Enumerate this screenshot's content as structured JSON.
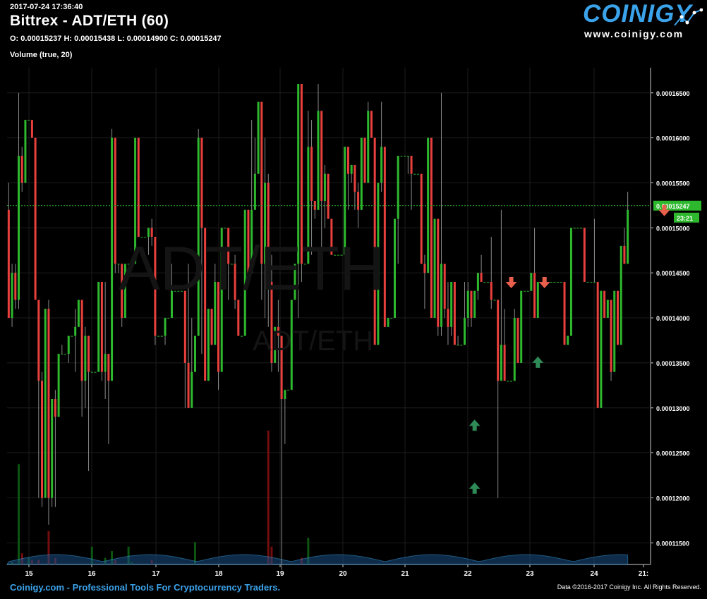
{
  "header": {
    "timestamp": "2017-07-24 17:36:40",
    "title": "Bittrex - ADT/ETH (60)",
    "ohlc": "O: 0.00015237 H: 0.00015438 L: 0.00014900 C: 0.00015247",
    "volume_label": "Volume (true, 20)"
  },
  "logo": {
    "text": "COINIGY",
    "url": "www.coinigy.com"
  },
  "watermark": {
    "big": "ADT/ETH",
    "small": "ADT/ETH"
  },
  "footer": {
    "left": "Coinigy.com - Professional Tools For Cryptocurrency Traders.",
    "right": "Data ©2016-2017 Coinigy Inc. All Rights Reserved."
  },
  "colors": {
    "up": "#2eb82e",
    "down": "#e8403c",
    "grid": "#1c1c1c",
    "accent": "#3ba3ea",
    "volume_ma": "#1f5f9a"
  },
  "chart_data": {
    "type": "candlestick",
    "title": "Bittrex - ADT/ETH (60)",
    "xlabel": "",
    "ylabel": "",
    "x_ticks": [
      "15",
      "16",
      "17",
      "18",
      "19",
      "20",
      "21",
      "22",
      "23",
      "24",
      "21:"
    ],
    "y_ticks": [
      "0.00016500",
      "0.00016000",
      "0.00015500",
      "0.00015000",
      "0.00014500",
      "0.00014000",
      "0.00013500",
      "0.00013000",
      "0.00012500",
      "0.00012000",
      "0.00011500"
    ],
    "ylim": [
      0.0001126,
      0.0001678
    ],
    "last_price": "0.00015247",
    "countdown": "23:21",
    "grid": true,
    "candles": [
      [
        0.000152,
        0.00014,
        0.000155,
        0.00014
      ],
      [
        0.00014,
        0.000145,
        0.000146,
        0.000139
      ],
      [
        0.000145,
        0.000142,
        0.000146,
        0.000141
      ],
      [
        0.000142,
        0.000158,
        0.000165,
        0.000141
      ],
      [
        0.000158,
        0.000155,
        0.000159,
        0.000154
      ],
      [
        0.000155,
        0.000162,
        0.000162,
        0.000155
      ],
      [
        0.000162,
        0.000162,
        0.000162,
        0.000162
      ],
      [
        0.000162,
        0.00016,
        0.000162,
        0.00016
      ],
      [
        0.00016,
        0.000142,
        0.00016,
        0.000142
      ],
      [
        0.000142,
        0.000133,
        0.000142,
        0.00012
      ],
      [
        0.000133,
        0.00012,
        0.000134,
        0.000119
      ],
      [
        0.00012,
        0.000141,
        0.000141,
        0.00012
      ],
      [
        0.000141,
        0.00012,
        0.000142,
        0.000117
      ],
      [
        0.00012,
        0.000131,
        0.000131,
        0.000119
      ],
      [
        0.000131,
        0.000129,
        0.000132,
        0.000119
      ],
      [
        0.000129,
        0.000136,
        0.000136,
        0.000129
      ],
      [
        0.000136,
        0.000136,
        0.000137,
        0.000136
      ],
      [
        0.000136,
        0.000136,
        0.000136,
        0.000136
      ],
      [
        0.000136,
        0.000138,
        0.000138,
        0.000135
      ],
      [
        0.000138,
        0.000138,
        0.000138,
        0.000138
      ],
      [
        0.000138,
        0.000139,
        0.000141,
        0.000134
      ],
      [
        0.000139,
        0.000142,
        0.000142,
        0.000139
      ],
      [
        0.000142,
        0.000133,
        0.000142,
        0.000129
      ],
      [
        0.000133,
        0.000138,
        0.000139,
        0.00013
      ],
      [
        0.000138,
        0.000134,
        0.000138,
        0.000123
      ],
      [
        0.000134,
        0.000134,
        0.000134,
        0.000134
      ],
      [
        0.000134,
        0.000134,
        0.000134,
        0.000134
      ],
      [
        0.000134,
        0.000144,
        0.000144,
        0.000134
      ],
      [
        0.000144,
        0.000134,
        0.000144,
        0.000133
      ],
      [
        0.000134,
        0.000136,
        0.000144,
        0.000131
      ],
      [
        0.000136,
        0.000133,
        0.000136,
        0.000126
      ],
      [
        0.000133,
        0.00016,
        0.000161,
        0.000133
      ],
      [
        0.00016,
        0.000146,
        0.00016,
        0.000145
      ],
      [
        0.000146,
        0.000146,
        0.000146,
        0.000145
      ],
      [
        0.000146,
        0.00014,
        0.000146,
        0.000139
      ],
      [
        0.00014,
        0.000146,
        0.000146,
        0.00014
      ],
      [
        0.000146,
        0.000146,
        0.000146,
        0.000146
      ],
      [
        0.000146,
        0.000146,
        0.000146,
        0.000146
      ],
      [
        0.000146,
        0.00016,
        0.00016,
        0.000146
      ],
      [
        0.00016,
        0.000149,
        0.00016,
        0.000149
      ],
      [
        0.000149,
        0.000149,
        0.000149,
        0.000149
      ],
      [
        0.000149,
        0.000149,
        0.000149,
        0.000149
      ],
      [
        0.000149,
        0.00015,
        0.00015,
        0.000147
      ],
      [
        0.00015,
        0.000149,
        0.000151,
        0.000148
      ],
      [
        0.000149,
        0.000138,
        0.000149,
        0.000137
      ],
      [
        0.000138,
        0.000138,
        0.000138,
        0.000138
      ],
      [
        0.000138,
        0.000138,
        0.000138,
        0.000138
      ],
      [
        0.000138,
        0.00014,
        0.00014,
        0.000137
      ],
      [
        0.00014,
        0.00014,
        0.00014,
        0.00014
      ],
      [
        0.00014,
        0.000143,
        0.000146,
        0.00014
      ],
      [
        0.000143,
        0.000143,
        0.000143,
        0.000143
      ],
      [
        0.000143,
        0.000143,
        0.000143,
        0.000143
      ],
      [
        0.000143,
        0.000143,
        0.000143,
        0.000143
      ],
      [
        0.000143,
        0.000135,
        0.000143,
        0.00013
      ],
      [
        0.000135,
        0.00013,
        0.000146,
        0.00013
      ],
      [
        0.00013,
        0.000134,
        0.00014,
        0.00013
      ],
      [
        0.000134,
        0.000138,
        0.000138,
        0.000134
      ],
      [
        0.000138,
        0.00016,
        0.000161,
        0.000138
      ],
      [
        0.00016,
        0.00015,
        0.00016,
        0.000136
      ],
      [
        0.00015,
        0.000133,
        0.00015,
        0.000133
      ],
      [
        0.000133,
        0.000141,
        0.000141,
        0.000133
      ],
      [
        0.000141,
        0.000137,
        0.000141,
        0.000137
      ],
      [
        0.000137,
        0.000144,
        0.000146,
        0.000137
      ],
      [
        0.000144,
        0.000134,
        0.000144,
        0.000132
      ],
      [
        0.000134,
        0.00015,
        0.00015,
        0.000134
      ],
      [
        0.00015,
        0.00015,
        0.00015,
        0.00015
      ],
      [
        0.00015,
        0.000146,
        0.00015,
        0.000142
      ],
      [
        0.000146,
        0.000146,
        0.000146,
        0.000146
      ],
      [
        0.000146,
        0.000142,
        0.000147,
        0.000141
      ],
      [
        0.000142,
        0.000138,
        0.000142,
        0.000138
      ],
      [
        0.000138,
        0.000138,
        0.000138,
        0.000138
      ],
      [
        0.000138,
        0.000152,
        0.000152,
        0.000138
      ],
      [
        0.000152,
        0.000145,
        0.000152,
        0.000145
      ],
      [
        0.000145,
        0.000152,
        0.000162,
        0.000145
      ],
      [
        0.000152,
        0.000156,
        0.00016,
        0.000152
      ],
      [
        0.000156,
        0.000164,
        0.000164,
        0.000156
      ],
      [
        0.000164,
        0.000146,
        0.000164,
        0.000142
      ],
      [
        0.000146,
        0.000155,
        0.00016,
        0.00014
      ],
      [
        0.000155,
        0.000144,
        0.000156,
        0.000139
      ],
      [
        0.000144,
        0.000135,
        0.000147,
        0.000134
      ],
      [
        0.000135,
        0.000139,
        0.000139,
        0.000135
      ],
      [
        0.000139,
        0.000138,
        0.000142,
        0.000134
      ],
      [
        0.000138,
        0.000131,
        0.000138,
        0.000112
      ],
      [
        0.000131,
        0.000132,
        0.000132,
        0.000126
      ],
      [
        0.000132,
        0.000132,
        0.000132,
        0.000132
      ],
      [
        0.000132,
        0.000142,
        0.000142,
        0.000132
      ],
      [
        0.000142,
        0.000146,
        0.000146,
        0.000142
      ],
      [
        0.000146,
        0.000166,
        0.000166,
        0.00014
      ],
      [
        0.000166,
        0.000146,
        0.000166,
        0.000144
      ],
      [
        0.000146,
        0.000146,
        0.000146,
        0.000146
      ],
      [
        0.000146,
        0.000159,
        0.000163,
        0.000146
      ],
      [
        0.000159,
        0.000153,
        0.000162,
        0.000147
      ],
      [
        0.000153,
        0.000152,
        0.000152,
        0.000151
      ],
      [
        0.000152,
        0.000163,
        0.000166,
        0.000152
      ],
      [
        0.000163,
        0.000153,
        0.000163,
        0.000147
      ],
      [
        0.000153,
        0.000156,
        0.000157,
        0.00015
      ],
      [
        0.000156,
        0.000151,
        0.000156,
        0.000151
      ],
      [
        0.000151,
        0.000147,
        0.000151,
        0.000147
      ],
      [
        0.000147,
        0.000147,
        0.000147,
        0.000147
      ],
      [
        0.000147,
        0.000147,
        0.000147,
        0.000147
      ],
      [
        0.000147,
        0.000147,
        0.000147,
        0.000147
      ],
      [
        0.000147,
        0.000159,
        0.000159,
        0.000147
      ],
      [
        0.000159,
        0.000156,
        0.000159,
        0.000152
      ],
      [
        0.000156,
        0.000157,
        0.000157,
        0.000155
      ],
      [
        0.000157,
        0.000154,
        0.000157,
        0.000152
      ],
      [
        0.000154,
        0.000152,
        0.000155,
        0.00015
      ],
      [
        0.000152,
        0.00016,
        0.00016,
        0.000152
      ],
      [
        0.00016,
        0.000155,
        0.00016,
        0.000155
      ],
      [
        0.000155,
        0.000163,
        0.000164,
        0.000155
      ],
      [
        0.000163,
        0.00016,
        0.000163,
        0.00016
      ],
      [
        0.00016,
        0.000137,
        0.00016,
        0.000137
      ],
      [
        0.000137,
        0.000155,
        0.000155,
        0.000137
      ],
      [
        0.000155,
        0.000159,
        0.000164,
        0.000154
      ],
      [
        0.000159,
        0.000139,
        0.000159,
        0.000139
      ],
      [
        0.000139,
        0.00014,
        0.00014,
        0.000139
      ],
      [
        0.00014,
        0.00014,
        0.00014,
        0.00014
      ],
      [
        0.00014,
        0.000151,
        0.000151,
        0.00014
      ],
      [
        0.000151,
        0.000158,
        0.000158,
        0.000146
      ],
      [
        0.000158,
        0.000158,
        0.000158,
        0.000158
      ],
      [
        0.000158,
        0.000158,
        0.000158,
        0.000158
      ],
      [
        0.000158,
        0.000158,
        0.000158,
        0.000156
      ],
      [
        0.000158,
        0.000156,
        0.000158,
        0.000152
      ],
      [
        0.000156,
        0.000156,
        0.000156,
        0.000156
      ],
      [
        0.000156,
        0.000156,
        0.000156,
        0.000156
      ],
      [
        0.000156,
        0.000146,
        0.000156,
        0.000146
      ],
      [
        0.000146,
        0.000145,
        0.000147,
        0.000141
      ],
      [
        0.000145,
        0.00016,
        0.00016,
        0.000145
      ],
      [
        0.00016,
        0.00014,
        0.00016,
        0.00014
      ],
      [
        0.00014,
        0.000151,
        0.000151,
        0.00014
      ],
      [
        0.000151,
        0.000139,
        0.000151,
        0.000138
      ],
      [
        0.000139,
        0.000146,
        0.000165,
        0.000138
      ],
      [
        0.000146,
        0.000141,
        0.000146,
        0.00014
      ],
      [
        0.000141,
        0.000139,
        0.000144,
        0.000137
      ],
      [
        0.000139,
        0.000144,
        0.000144,
        0.000138
      ],
      [
        0.000144,
        0.000137,
        0.000144,
        0.000137
      ],
      [
        0.000137,
        0.000137,
        0.000138,
        0.000137
      ],
      [
        0.000137,
        0.000137,
        0.000137,
        0.000137
      ],
      [
        0.000137,
        0.00014,
        0.000144,
        0.000137
      ],
      [
        0.00014,
        0.000143,
        0.000144,
        0.000139
      ],
      [
        0.000143,
        0.00014,
        0.000143,
        0.000139
      ],
      [
        0.00014,
        0.000143,
        0.000143,
        0.00014
      ],
      [
        0.000143,
        0.000145,
        0.000145,
        0.000142
      ],
      [
        0.000145,
        0.000144,
        0.000147,
        0.000144
      ],
      [
        0.000144,
        0.000144,
        0.000144,
        0.000144
      ],
      [
        0.000144,
        0.000144,
        0.000144,
        0.000144
      ],
      [
        0.000144,
        0.000142,
        0.000149,
        0.000141
      ],
      [
        0.000142,
        0.000142,
        0.000142,
        0.000142
      ],
      [
        0.000142,
        0.000133,
        0.000142,
        0.00012
      ],
      [
        0.000133,
        0.000137,
        0.000152,
        0.000133
      ],
      [
        0.000137,
        0.000133,
        0.000141,
        0.000133
      ],
      [
        0.000133,
        0.000133,
        0.000133,
        0.000133
      ],
      [
        0.000133,
        0.000133,
        0.000133,
        0.000133
      ],
      [
        0.000133,
        0.00014,
        0.000141,
        0.000133
      ],
      [
        0.00014,
        0.000135,
        0.00014,
        0.000135
      ],
      [
        0.000135,
        0.000143,
        0.000143,
        0.000135
      ],
      [
        0.000143,
        0.000143,
        0.000143,
        0.000143
      ],
      [
        0.000143,
        0.000143,
        0.000143,
        0.000143
      ],
      [
        0.000143,
        0.000145,
        0.000145,
        0.000143
      ],
      [
        0.000145,
        0.00014,
        0.00015,
        0.00014
      ],
      [
        0.00014,
        0.000144,
        0.000144,
        0.00014
      ],
      [
        0.000144,
        0.000144,
        0.000144,
        0.000144
      ],
      [
        0.000144,
        0.000144,
        0.000144,
        0.000144
      ],
      [
        0.000144,
        0.000144,
        0.000144,
        0.000144
      ],
      [
        0.000144,
        0.000144,
        0.000144,
        0.000144
      ],
      [
        0.000144,
        0.000144,
        0.000144,
        0.000144
      ],
      [
        0.000144,
        0.000144,
        0.000144,
        0.000144
      ],
      [
        0.000144,
        0.000144,
        0.000144,
        0.000144
      ],
      [
        0.000144,
        0.000137,
        0.000144,
        0.000137
      ],
      [
        0.000137,
        0.000138,
        0.000138,
        0.000137
      ],
      [
        0.000138,
        0.00015,
        0.00015,
        0.000138
      ],
      [
        0.00015,
        0.00015,
        0.00015,
        0.00015
      ],
      [
        0.00015,
        0.00015,
        0.00015,
        0.00015
      ],
      [
        0.00015,
        0.00015,
        0.00015,
        0.00015
      ],
      [
        0.00015,
        0.000144,
        0.00015,
        0.000144
      ],
      [
        0.000144,
        0.000144,
        0.000144,
        0.000144
      ],
      [
        0.000144,
        0.000144,
        0.000144,
        0.000144
      ],
      [
        0.000144,
        0.000144,
        0.000151,
        0.000144
      ],
      [
        0.000144,
        0.00013,
        0.000144,
        0.00013
      ],
      [
        0.00013,
        0.000143,
        0.000143,
        0.00013
      ],
      [
        0.000143,
        0.00014,
        0.000143,
        0.00014
      ],
      [
        0.00014,
        0.000142,
        0.000142,
        0.00014
      ],
      [
        0.000142,
        0.000134,
        0.000142,
        0.000133
      ],
      [
        0.000134,
        0.000143,
        0.000143,
        0.000134
      ],
      [
        0.000143,
        0.000137,
        0.000143,
        0.000137
      ],
      [
        0.000137,
        0.000148,
        0.000148,
        0.000137
      ],
      [
        0.000148,
        0.000146,
        0.00015,
        0.000146
      ],
      [
        0.000146,
        0.000152,
        0.000154,
        0.000149
      ]
    ],
    "volumes": [
      0,
      1,
      0,
      45,
      5,
      0,
      3,
      2,
      0,
      2,
      0,
      0,
      15,
      0,
      3,
      0,
      0,
      0,
      0,
      0,
      0,
      0,
      0,
      0,
      0,
      8,
      0,
      0,
      0,
      3,
      0,
      6,
      2,
      0,
      0,
      0,
      8,
      1,
      0,
      0,
      0,
      0,
      0,
      2,
      0,
      0,
      0,
      0,
      0,
      0,
      0,
      0,
      0,
      0,
      0,
      0,
      10,
      0,
      0,
      0,
      0,
      0,
      0,
      0,
      0,
      0,
      0,
      0,
      0,
      0,
      0,
      0,
      0,
      0,
      0,
      0,
      0,
      0,
      60,
      8,
      0,
      0,
      0,
      0,
      0,
      0,
      0,
      0,
      3,
      0,
      12,
      0,
      0,
      0,
      0,
      0,
      0,
      0,
      0,
      0,
      0,
      0,
      0,
      0,
      0,
      0,
      0,
      0,
      0,
      0,
      0,
      0,
      0,
      0,
      0,
      0,
      0,
      0,
      0,
      0,
      0,
      0,
      0,
      0,
      0,
      0,
      0,
      0,
      0,
      0,
      0,
      0,
      0,
      0,
      0,
      0,
      0,
      0,
      0,
      0,
      0,
      0,
      0,
      0,
      0,
      0,
      0,
      0,
      0,
      0,
      0,
      0,
      0,
      0,
      0,
      0,
      0,
      0,
      0,
      0,
      0,
      0,
      0,
      0,
      0,
      0,
      0,
      0,
      0,
      0,
      0,
      0,
      0,
      0,
      0,
      0,
      0,
      0,
      0,
      0,
      0,
      0
    ],
    "markers": [
      {
        "type": "buy",
        "x_candle": 140,
        "price": 0.000128
      },
      {
        "type": "buy",
        "x_candle": 140,
        "price": 0.000121
      },
      {
        "type": "sell",
        "x_candle": 151,
        "price": 0.000144
      },
      {
        "type": "sell",
        "x_candle": 161,
        "price": 0.000144
      },
      {
        "type": "buy",
        "x_candle": 159,
        "price": 0.000135
      },
      {
        "type": "sell",
        "x_candle": 197,
        "price": 0.000152
      }
    ]
  }
}
